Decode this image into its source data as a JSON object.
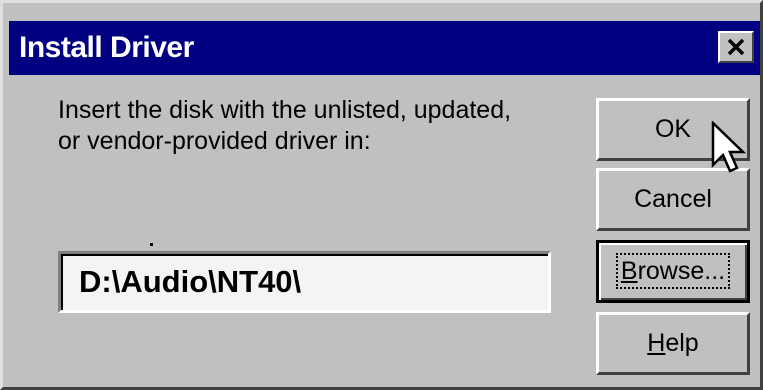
{
  "window": {
    "title": "Install Driver",
    "close_glyph": "✕"
  },
  "message": {
    "line1": "Insert the disk with the unlisted, updated,",
    "line2": "or vendor-provided driver in:"
  },
  "path_field": {
    "value": "D:\\Audio\\NT40\\"
  },
  "buttons": {
    "ok": "OK",
    "cancel": "Cancel",
    "browse_first": "B",
    "browse_rest": "rowse...",
    "help_first": "H",
    "help_rest": "elp"
  },
  "icons": {
    "close": "close-icon",
    "cursor": "mouse-pointer-icon"
  }
}
